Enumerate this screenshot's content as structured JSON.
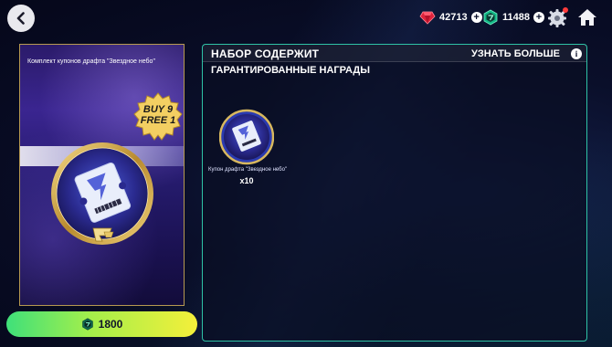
{
  "top_bar": {
    "currencies": [
      {
        "name": "points",
        "icon": "red-gem-icon",
        "value": "42713"
      },
      {
        "name": "tokens",
        "icon": "green-ea-gem-icon",
        "value": "11488"
      }
    ],
    "plus_symbol": "+"
  },
  "pack": {
    "title": "Комплект купонов драфта \"Звездное небо\"",
    "quantity": "10",
    "badge_line1": "BUY 9",
    "badge_line2": "FREE 1"
  },
  "buy_button": {
    "price": "1800",
    "currency_icon": "green-ea-gem-icon"
  },
  "contents": {
    "title": "НАБОР СОДЕРЖИТ",
    "learn_more": "УЗНАТЬ БОЛЬШЕ",
    "info_symbol": "i",
    "guaranteed_header": "ГАРАНТИРОВАННЫЕ НАГРАДЫ",
    "rewards": [
      {
        "name": "Купон драфта \"Звездное небо\"",
        "quantity": "x10"
      }
    ]
  },
  "colors": {
    "accent_teal": "#2ec2a6",
    "button_green": "#3fe07a",
    "button_yellow": "#f4ef3a",
    "gold": "#c9a64d"
  }
}
